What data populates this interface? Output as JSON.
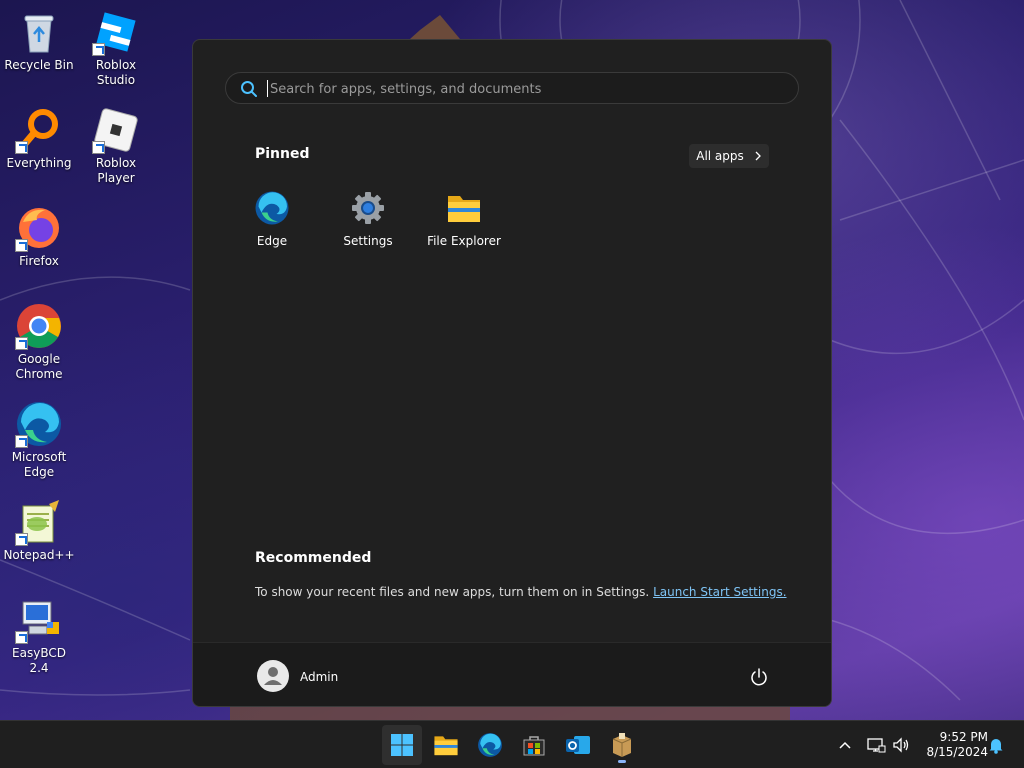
{
  "desktop": {
    "icons": [
      {
        "label": "Recycle Bin",
        "icon": "recycle-bin-icon"
      },
      {
        "label": "Roblox Studio",
        "icon": "roblox-studio-icon"
      },
      {
        "label": "Everything",
        "icon": "everything-search-icon"
      },
      {
        "label": "Roblox Player",
        "icon": "roblox-player-icon"
      },
      {
        "label": "Firefox",
        "icon": "firefox-icon"
      },
      {
        "label": "Google Chrome",
        "icon": "chrome-icon"
      },
      {
        "label": "Microsoft Edge",
        "icon": "edge-icon"
      },
      {
        "label": "Notepad++",
        "icon": "notepadpp-icon"
      },
      {
        "label": "EasyBCD 2.4",
        "icon": "easybcd-icon"
      }
    ]
  },
  "start_menu": {
    "search": {
      "placeholder": "Search for apps, settings, and documents"
    },
    "pinned": {
      "title": "Pinned",
      "all_apps_label": "All apps",
      "apps": [
        {
          "label": "Edge",
          "icon": "edge-icon"
        },
        {
          "label": "Settings",
          "icon": "settings-gear-icon"
        },
        {
          "label": "File Explorer",
          "icon": "folder-icon"
        }
      ]
    },
    "recommended": {
      "title": "Recommended",
      "text": "To show your recent files and new apps, turn them on in Settings.",
      "link_label": "Launch Start Settings."
    },
    "user": {
      "name": "Admin"
    }
  },
  "taskbar": {
    "apps": [
      "start-icon",
      "file-explorer-icon",
      "edge-icon",
      "store-icon",
      "outlook-icon",
      "package-icon"
    ],
    "clock": {
      "time": "9:52 PM",
      "date": "8/15/2024"
    }
  },
  "colors": {
    "accent": "#0078d4",
    "link": "#7fc4f5",
    "menu_bg": "#202020"
  }
}
